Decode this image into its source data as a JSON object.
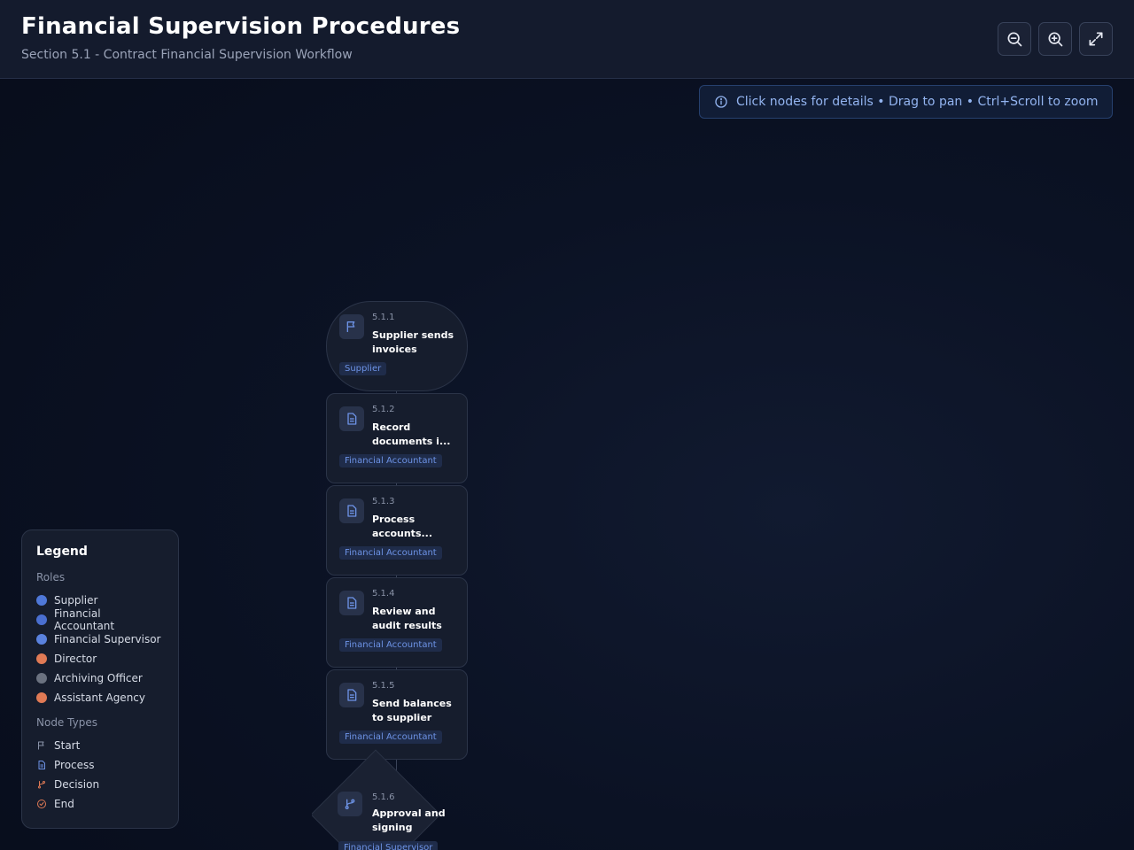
{
  "header": {
    "title": "Financial Supervision Procedures",
    "subtitle": "Section 5.1 - Contract Financial Supervision Workflow"
  },
  "toolbar": {
    "zoom_out_icon": "zoom-out-icon",
    "zoom_in_icon": "zoom-in-icon",
    "fullscreen_icon": "expand-icon"
  },
  "hint": {
    "text": "Click nodes for details • Drag to pan • Ctrl+Scroll to zoom",
    "icon": "info-icon"
  },
  "nodes": [
    {
      "id": "5.1.1",
      "title": "Supplier sends invoices",
      "role": "Supplier",
      "type": "start"
    },
    {
      "id": "5.1.2",
      "title": "Record documents i...",
      "role": "Financial Accountant",
      "type": "process"
    },
    {
      "id": "5.1.3",
      "title": "Process accounts...",
      "role": "Financial Accountant",
      "type": "process"
    },
    {
      "id": "5.1.4",
      "title": "Review and audit results",
      "role": "Financial Accountant",
      "type": "process"
    },
    {
      "id": "5.1.5",
      "title": "Send balances to supplier",
      "role": "Financial Accountant",
      "type": "process"
    },
    {
      "id": "5.1.6",
      "title": "Approval and signing",
      "role": "Financial Supervisor",
      "type": "decision"
    }
  ],
  "legend": {
    "title": "Legend",
    "roles_label": "Roles",
    "roles": [
      {
        "name": "Supplier",
        "color": "#4f78d8"
      },
      {
        "name": "Financial Accountant",
        "color": "#4a6fd0"
      },
      {
        "name": "Financial Supervisor",
        "color": "#5a82de"
      },
      {
        "name": "Director",
        "color": "#e07a55"
      },
      {
        "name": "Archiving Officer",
        "color": "#6b7280"
      },
      {
        "name": "Assistant Agency",
        "color": "#e07a55"
      }
    ],
    "types_label": "Node Types",
    "types": [
      {
        "name": "Start",
        "icon": "flag-icon"
      },
      {
        "name": "Process",
        "icon": "document-icon"
      },
      {
        "name": "Decision",
        "icon": "branch-icon"
      },
      {
        "name": "End",
        "icon": "check-circle-icon"
      }
    ]
  },
  "colors": {
    "accent": "#6d93e6",
    "decision": "#e07a55",
    "background": "#0b1224"
  }
}
